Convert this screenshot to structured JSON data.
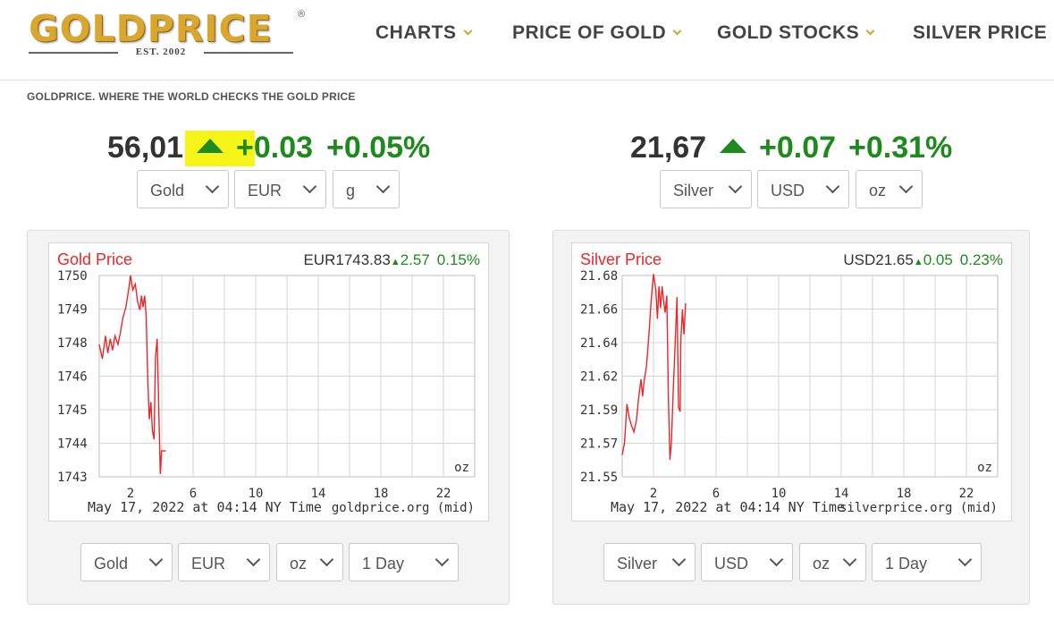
{
  "header": {
    "logo_text": "GOLDPRICE",
    "logo_reg": "®",
    "logo_est": "EST. 2002",
    "nav": [
      {
        "label": "CHARTS",
        "has_dropdown": true
      },
      {
        "label": "PRICE OF GOLD",
        "has_dropdown": true
      },
      {
        "label": "GOLD STOCKS",
        "has_dropdown": true
      },
      {
        "label": "SILVER PRICE",
        "has_dropdown": false
      }
    ]
  },
  "tagline": "GOLDPRICE. WHERE THE WORLD CHECKS THE GOLD PRICE",
  "gold_ticker": {
    "price": "56,01",
    "change": "+0.03",
    "percent": "+0.05%",
    "direction_icon": "triangle-up-icon",
    "highlight_color": "#f5f51a",
    "selects": [
      "Gold",
      "EUR",
      "g"
    ]
  },
  "silver_ticker": {
    "price": "21,67",
    "change": "+0.07",
    "percent": "+0.31%",
    "direction_icon": "triangle-up-icon",
    "selects": [
      "Silver",
      "USD",
      "oz"
    ]
  },
  "colors": {
    "up": "#1e8a1e",
    "chart_line": "#e8272b",
    "chart_title": "#e8272b",
    "brand_gold": "#d9a62e"
  },
  "gold_chart": {
    "title": "Gold Price",
    "quote": "EUR1743.83",
    "change": "2.57",
    "percent": "0.15%",
    "unit": "oz",
    "footer_left": "May 17, 2022 at 04:14 NY Time",
    "footer_right": "goldprice.org (mid)",
    "bottom_selects": [
      "Gold",
      "EUR",
      "oz",
      "1 Day"
    ]
  },
  "silver_chart": {
    "title": "Silver Price",
    "quote": "USD21.65",
    "change": "0.05",
    "percent": "0.23%",
    "unit": "oz",
    "footer_left": "May 17, 2022 at 04:14 NY Time",
    "footer_right": "silverprice.org (mid)",
    "bottom_selects": [
      "Silver",
      "USD",
      "oz",
      "1 Day"
    ]
  },
  "chart_data": [
    {
      "type": "line",
      "title": "Gold Price",
      "x_ticks": [
        "2",
        "6",
        "10",
        "14",
        "18",
        "22"
      ],
      "y_ticks": [
        "1743",
        "1744",
        "1745",
        "1746",
        "1748",
        "1749",
        "1750"
      ],
      "x_range": [
        0,
        24
      ],
      "y_range": [
        1743,
        1750
      ],
      "grid": true,
      "series": [
        {
          "values": [
            [
              0.0,
              1747.6
            ],
            [
              0.2,
              1747.1
            ],
            [
              0.4,
              1747.9
            ],
            [
              0.55,
              1747.3
            ],
            [
              0.7,
              1747.8
            ],
            [
              0.85,
              1747.4
            ],
            [
              1.0,
              1747.9
            ],
            [
              1.2,
              1747.6
            ],
            [
              1.35,
              1748.0
            ],
            [
              1.5,
              1748.5
            ],
            [
              1.7,
              1748.9
            ],
            [
              1.85,
              1749.4
            ],
            [
              2.0,
              1750.0
            ],
            [
              2.15,
              1749.5
            ],
            [
              2.3,
              1749.7
            ],
            [
              2.45,
              1749.1
            ],
            [
              2.6,
              1748.8
            ],
            [
              2.7,
              1749.3
            ],
            [
              2.8,
              1748.9
            ],
            [
              2.9,
              1749.3
            ],
            [
              3.0,
              1748.6
            ],
            [
              3.1,
              1746.4
            ],
            [
              3.2,
              1745.0
            ],
            [
              3.3,
              1745.6
            ],
            [
              3.4,
              1744.6
            ],
            [
              3.5,
              1744.3
            ],
            [
              3.6,
              1747.2
            ],
            [
              3.7,
              1747.8
            ],
            [
              3.8,
              1745.5
            ],
            [
              3.9,
              1743.1
            ],
            [
              3.98,
              1743.9
            ],
            [
              4.1,
              1743.9
            ],
            [
              4.25,
              1743.9
            ]
          ]
        }
      ]
    },
    {
      "type": "line",
      "title": "Silver Price",
      "x_ticks": [
        "2",
        "6",
        "10",
        "14",
        "18",
        "22"
      ],
      "y_ticks": [
        "21.55",
        "21.57",
        "21.59",
        "21.62",
        "21.64",
        "21.66",
        "21.68"
      ],
      "x_range": [
        0,
        24
      ],
      "y_range": [
        21.55,
        21.68
      ],
      "grid": true,
      "series": [
        {
          "values": [
            [
              0.0,
              21.564
            ],
            [
              0.15,
              21.572
            ],
            [
              0.3,
              21.597
            ],
            [
              0.45,
              21.588
            ],
            [
              0.6,
              21.583
            ],
            [
              0.75,
              21.579
            ],
            [
              0.9,
              21.586
            ],
            [
              1.05,
              21.601
            ],
            [
              1.2,
              21.613
            ],
            [
              1.3,
              21.602
            ],
            [
              1.4,
              21.612
            ],
            [
              1.55,
              21.621
            ],
            [
              1.7,
              21.641
            ],
            [
              1.85,
              21.664
            ],
            [
              2.0,
              21.681
            ],
            [
              2.15,
              21.671
            ],
            [
              2.25,
              21.652
            ],
            [
              2.35,
              21.673
            ],
            [
              2.45,
              21.659
            ],
            [
              2.55,
              21.673
            ],
            [
              2.65,
              21.663
            ],
            [
              2.75,
              21.656
            ],
            [
              2.85,
              21.667
            ],
            [
              2.95,
              21.603
            ],
            [
              3.05,
              21.561
            ],
            [
              3.15,
              21.573
            ],
            [
              3.25,
              21.603
            ],
            [
              3.4,
              21.64
            ],
            [
              3.5,
              21.666
            ],
            [
              3.6,
              21.595
            ],
            [
              3.7,
              21.592
            ],
            [
              3.75,
              21.639
            ],
            [
              3.85,
              21.658
            ],
            [
              3.95,
              21.642
            ],
            [
              4.05,
              21.662
            ]
          ]
        }
      ]
    }
  ]
}
